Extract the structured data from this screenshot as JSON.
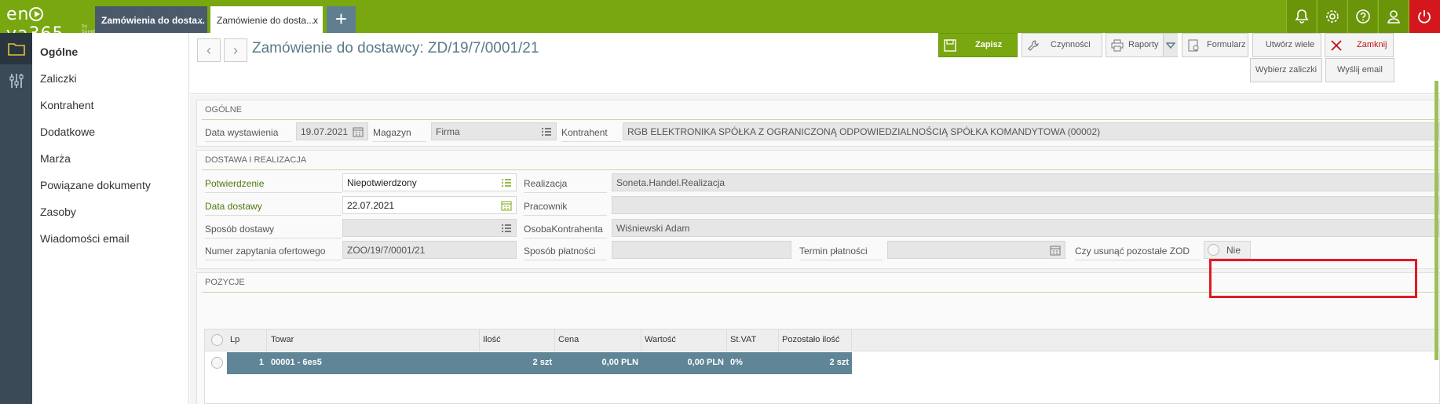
{
  "app": {
    "logo": "enova365",
    "logo_sub": "by Soneta"
  },
  "tabs": [
    {
      "label": "Zamówienia do dosta...",
      "close": "x"
    },
    {
      "label": "Zamówienie do dosta...",
      "close": "x"
    }
  ],
  "tab_add": "+",
  "colors": {
    "brand": "#78a70f",
    "dark": "#3b4a57",
    "danger": "#d3171d",
    "grid_row": "#5f8596"
  },
  "sidebar": {
    "items": [
      {
        "label": "Ogólne"
      },
      {
        "label": "Zaliczki"
      },
      {
        "label": "Kontrahent"
      },
      {
        "label": "Dodatkowe"
      },
      {
        "label": "Marża"
      },
      {
        "label": "Powiązane dokumenty"
      },
      {
        "label": "Zasoby"
      },
      {
        "label": "Wiadomości email"
      }
    ]
  },
  "header": {
    "title": "Zamówienie do dostawcy: ZD/19/7/0001/21",
    "nav_back": "‹",
    "nav_forward": "›"
  },
  "toolbar": {
    "save": "Zapisz",
    "actions": "Czynności",
    "reports": "Raporty",
    "form": "Formularz",
    "create_many": "Utwórz wiele ZOD",
    "close": "Zamknij",
    "choose_advances": "Wybierz zaliczki",
    "send_email": "Wyślij email"
  },
  "general": {
    "section_title": "OGÓLNE",
    "date_label": "Data wystawienia",
    "date_value": "19.07.2021",
    "warehouse_label": "Magazyn",
    "warehouse_value": "Firma",
    "contractor_label": "Kontrahent",
    "contractor_value": "RGB ELEKTRONIKA SPÓŁKA Z OGRANICZONĄ ODPOWIEDZIALNOŚCIĄ SPÓŁKA KOMANDYTOWA (00002)"
  },
  "delivery": {
    "section_title": "DOSTAWA I REALIZACJA",
    "confirmation_label": "Potwierdzenie",
    "confirmation_value": "Niepotwierdzony",
    "delivery_date_label": "Data dostawy",
    "delivery_date_value": "22.07.2021",
    "delivery_method_label": "Sposób dostawy",
    "delivery_method_value": "",
    "inquiry_label": "Numer zapytania ofertowego",
    "inquiry_value": "ZOO/19/7/0001/21",
    "realization_label": "Realizacja",
    "realization_value": "Soneta.Handel.Realizacja",
    "employee_label": "Pracownik",
    "employee_value": "",
    "contact_label": "OsobaKontrahenta",
    "contact_value": "Wiśniewski Adam",
    "payment_method_label": "Sposób płatności",
    "payment_method_value": "",
    "payment_term_label": "Termin płatności",
    "payment_term_value": "",
    "remove_zod_label": "Czy usunąć pozostałe ZOD",
    "remove_zod_value": "Nie"
  },
  "positions": {
    "section_title": "POZYCJE",
    "columns": [
      "Lp",
      "Towar",
      "Ilość",
      "Cena",
      "Wartość",
      "St.VAT",
      "Pozostało ilość"
    ],
    "rows": [
      {
        "lp": "1",
        "towar": "00001 - 6es5",
        "ilosc": "2 szt",
        "cena": "0,00 PLN",
        "wartosc": "0,00 PLN",
        "vat": "0%",
        "pozostalo": "2 szt"
      }
    ]
  }
}
